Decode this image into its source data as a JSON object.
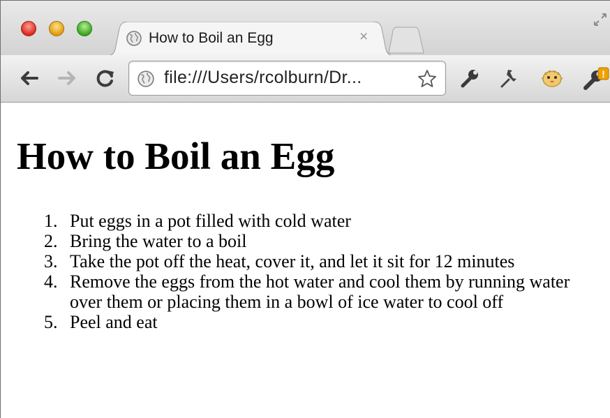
{
  "browser": {
    "tab": {
      "title": "How to Boil an Egg",
      "close_glyph": "×",
      "favicon": "globe-icon"
    },
    "address": {
      "url": "file:///Users/rcolburn/Dr...",
      "scheme_icon": "globe-icon"
    },
    "toolbar": {
      "back_icon": "back-arrow-icon",
      "forward_icon": "forward-arrow-icon",
      "reload_icon": "reload-icon",
      "bookmark_icon": "star-icon",
      "extensions": [
        "wrench-tool-icon",
        "pushpin-icon",
        "blowfish-icon"
      ],
      "menu_icon": "wrench-menu-icon",
      "menu_badge": "!"
    },
    "colors": {
      "close": "#d9291c",
      "minimize": "#e09a0e",
      "maximize": "#3aa521",
      "badge": "#f0a000"
    }
  },
  "page": {
    "heading": "How to Boil an Egg",
    "steps": [
      {
        "num": "1.",
        "text": "Put eggs in a pot filled with cold water"
      },
      {
        "num": "2.",
        "text": "Bring the water to a boil"
      },
      {
        "num": "3.",
        "text": "Take the pot off the heat, cover it, and let it sit for 12 minutes"
      },
      {
        "num": "4.",
        "text": "Remove the eggs from the hot water and cool them by running water over them or placing them in a bowl of ice water to cool off"
      },
      {
        "num": "5.",
        "text": "Peel and eat"
      }
    ]
  }
}
